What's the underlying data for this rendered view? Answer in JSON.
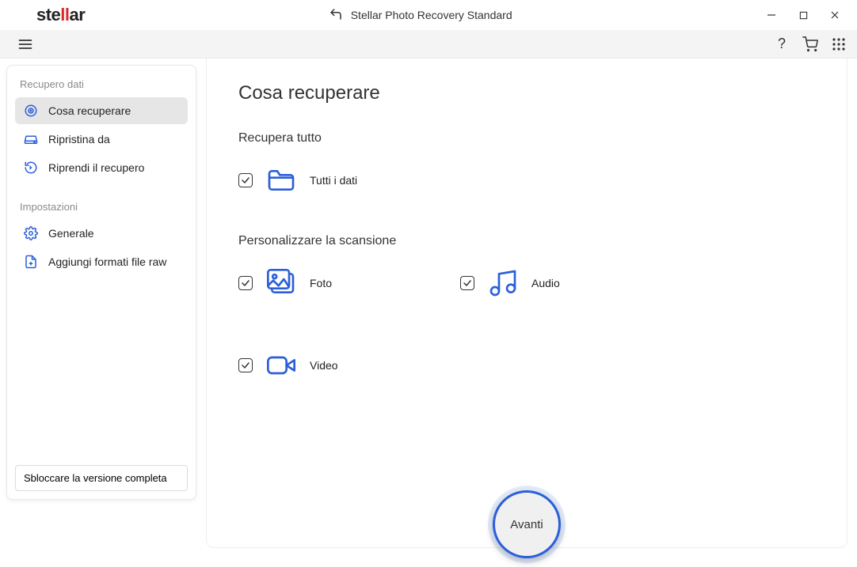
{
  "brand": {
    "prefix": "ste",
    "mid": "ll",
    "suffix": "ar"
  },
  "titlebar": {
    "app_title": "Stellar Photo Recovery Standard"
  },
  "toolbar": {
    "help_glyph": "?",
    "cart_label": "cart",
    "grid_label": "apps"
  },
  "sidebar": {
    "section1_title": "Recupero dati",
    "items1": [
      {
        "label": "Cosa recuperare",
        "icon": "target",
        "active": true
      },
      {
        "label": "Ripristina da",
        "icon": "drive",
        "active": false
      },
      {
        "label": "Riprendi il recupero",
        "icon": "resume",
        "active": false
      }
    ],
    "section2_title": "Impostazioni",
    "items2": [
      {
        "label": "Generale",
        "icon": "gear"
      },
      {
        "label": "Aggiungi formati file raw",
        "icon": "filetype"
      }
    ],
    "unlock_label": "Sbloccare la versione completa"
  },
  "main": {
    "page_title": "Cosa recuperare",
    "recover_all_title": "Recupera tutto",
    "all_data_label": "Tutti i dati",
    "customize_title": "Personalizzare la scansione",
    "options": {
      "photo": "Foto",
      "audio": "Audio",
      "video": "Video"
    },
    "next_label": "Avanti"
  }
}
